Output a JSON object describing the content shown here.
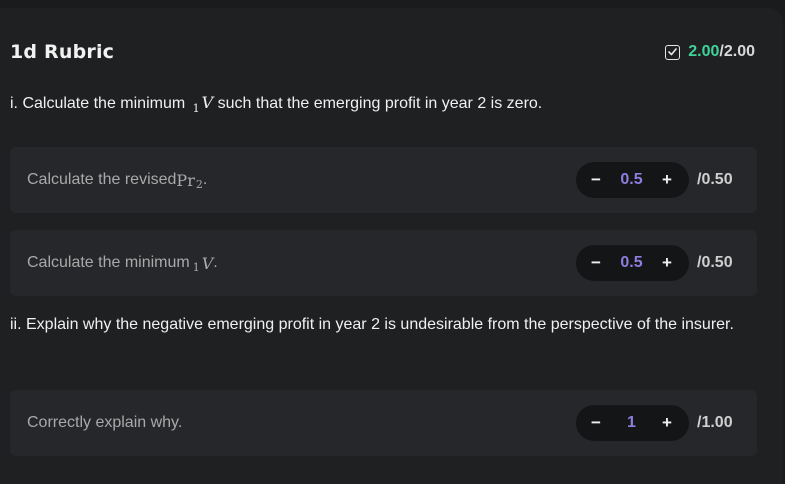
{
  "rubric": {
    "title": "1d Rubric",
    "score_got": "2.00",
    "score_total": "/2.00",
    "score_color": "#3fd39a"
  },
  "questions": [
    {
      "pre": "i. Calculate the minimum ",
      "math_sub": "1",
      "math_var": "V",
      "post": " such that the emerging profit in year 2 is zero."
    },
    {
      "text": "ii. Explain why the negative emerging profit in year 2 is undesirable from the perspective of the insurer."
    }
  ],
  "items": [
    {
      "label_pre": "Calculate the revised ",
      "math": "Pr",
      "math_sub": "2",
      "label_post": ".",
      "minus": "−",
      "value": "0.5",
      "plus": "+",
      "max": "/0.50"
    },
    {
      "label_pre": "Calculate the minimum ",
      "math_sub": "1",
      "math_var": "V",
      "label_post": ".",
      "minus": "−",
      "value": "0.5",
      "plus": "+",
      "max": "/0.50"
    },
    {
      "label": "Correctly explain why.",
      "minus": "−",
      "value": "1",
      "plus": "+",
      "max": "/1.00"
    }
  ],
  "icons": {
    "check": "check-square-icon"
  },
  "accent_value_color": "#8f7de0"
}
